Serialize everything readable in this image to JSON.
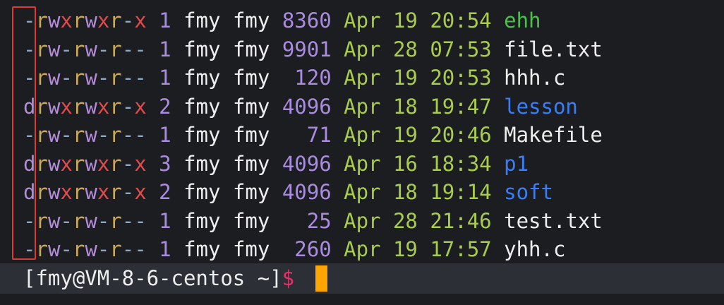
{
  "listing": [
    {
      "type": "-",
      "owner": "rwx",
      "group": "rwx",
      "other": "r-x",
      "links": "1",
      "user": "fmy",
      "group_name": "fmy",
      "size": "8360",
      "date": "Apr 19 20:54",
      "name": "ehh",
      "name_color": "#4cc04c"
    },
    {
      "type": "-",
      "owner": "rw-",
      "group": "rw-",
      "other": "r--",
      "links": "1",
      "user": "fmy",
      "group_name": "fmy",
      "size": "9901",
      "date": "Apr 28 07:53",
      "name": "file.txt",
      "name_color": "#eeeeee"
    },
    {
      "type": "-",
      "owner": "rw-",
      "group": "rw-",
      "other": "r--",
      "links": "1",
      "user": "fmy",
      "group_name": "fmy",
      "size": " 120",
      "date": "Apr 19 20:53",
      "name": "hhh.c",
      "name_color": "#eeeeee"
    },
    {
      "type": "d",
      "owner": "rwx",
      "group": "rwx",
      "other": "r-x",
      "links": "2",
      "user": "fmy",
      "group_name": "fmy",
      "size": "4096",
      "date": "Apr 18 19:47",
      "name": "lesson",
      "name_color": "#3b7df2"
    },
    {
      "type": "-",
      "owner": "rw-",
      "group": "rw-",
      "other": "r--",
      "links": "1",
      "user": "fmy",
      "group_name": "fmy",
      "size": "  71",
      "date": "Apr 19 20:46",
      "name": "Makefile",
      "name_color": "#eeeeee"
    },
    {
      "type": "d",
      "owner": "rwx",
      "group": "rwx",
      "other": "r-x",
      "links": "3",
      "user": "fmy",
      "group_name": "fmy",
      "size": "4096",
      "date": "Apr 16 18:34",
      "name": "p1",
      "name_color": "#3b7df2"
    },
    {
      "type": "d",
      "owner": "rwx",
      "group": "rwx",
      "other": "r-x",
      "links": "2",
      "user": "fmy",
      "group_name": "fmy",
      "size": "4096",
      "date": "Apr 18 19:14",
      "name": "soft",
      "name_color": "#3b7df2"
    },
    {
      "type": "-",
      "owner": "rw-",
      "group": "rw-",
      "other": "r--",
      "links": "1",
      "user": "fmy",
      "group_name": "fmy",
      "size": "  25",
      "date": "Apr 28 21:46",
      "name": "test.txt",
      "name_color": "#eeeeee"
    },
    {
      "type": "-",
      "owner": "rw-",
      "group": "rw-",
      "other": "r--",
      "links": "1",
      "user": "fmy",
      "group_name": "fmy",
      "size": " 260",
      "date": "Apr 19 17:57",
      "name": "yhh.c",
      "name_color": "#eeeeee"
    }
  ],
  "prompt": {
    "text": "[fmy@VM-8-6-centos ~]",
    "symbol": "$"
  },
  "colors": {
    "background": "#1b1d21",
    "prompt_bar": "#2c2f35",
    "cursor": "#ffa400",
    "highlight_box": "#e0392f",
    "perm_read": "#c9a85a",
    "perm_write": "#b48cd8",
    "perm_exec": "#e24b4b",
    "perm_dash": "#8ea7c2",
    "dir_type": "#b48cd8",
    "size": "#a98be0",
    "date": "#a9cc4a"
  }
}
